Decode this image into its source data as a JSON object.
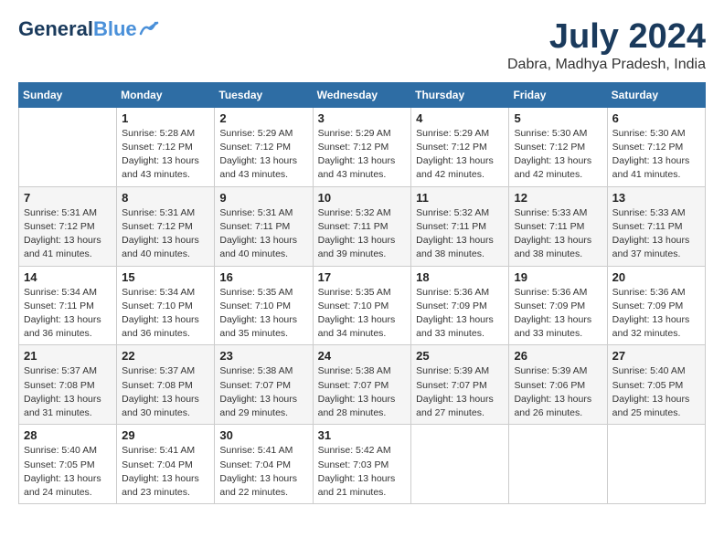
{
  "logo": {
    "line1": "General",
    "line2": "Blue"
  },
  "title": {
    "month_year": "July 2024",
    "location": "Dabra, Madhya Pradesh, India"
  },
  "headers": [
    "Sunday",
    "Monday",
    "Tuesday",
    "Wednesday",
    "Thursday",
    "Friday",
    "Saturday"
  ],
  "weeks": [
    [
      {
        "day": "",
        "info": ""
      },
      {
        "day": "1",
        "info": "Sunrise: 5:28 AM\nSunset: 7:12 PM\nDaylight: 13 hours\nand 43 minutes."
      },
      {
        "day": "2",
        "info": "Sunrise: 5:29 AM\nSunset: 7:12 PM\nDaylight: 13 hours\nand 43 minutes."
      },
      {
        "day": "3",
        "info": "Sunrise: 5:29 AM\nSunset: 7:12 PM\nDaylight: 13 hours\nand 43 minutes."
      },
      {
        "day": "4",
        "info": "Sunrise: 5:29 AM\nSunset: 7:12 PM\nDaylight: 13 hours\nand 42 minutes."
      },
      {
        "day": "5",
        "info": "Sunrise: 5:30 AM\nSunset: 7:12 PM\nDaylight: 13 hours\nand 42 minutes."
      },
      {
        "day": "6",
        "info": "Sunrise: 5:30 AM\nSunset: 7:12 PM\nDaylight: 13 hours\nand 41 minutes."
      }
    ],
    [
      {
        "day": "7",
        "info": "Sunrise: 5:31 AM\nSunset: 7:12 PM\nDaylight: 13 hours\nand 41 minutes."
      },
      {
        "day": "8",
        "info": "Sunrise: 5:31 AM\nSunset: 7:12 PM\nDaylight: 13 hours\nand 40 minutes."
      },
      {
        "day": "9",
        "info": "Sunrise: 5:31 AM\nSunset: 7:11 PM\nDaylight: 13 hours\nand 40 minutes."
      },
      {
        "day": "10",
        "info": "Sunrise: 5:32 AM\nSunset: 7:11 PM\nDaylight: 13 hours\nand 39 minutes."
      },
      {
        "day": "11",
        "info": "Sunrise: 5:32 AM\nSunset: 7:11 PM\nDaylight: 13 hours\nand 38 minutes."
      },
      {
        "day": "12",
        "info": "Sunrise: 5:33 AM\nSunset: 7:11 PM\nDaylight: 13 hours\nand 38 minutes."
      },
      {
        "day": "13",
        "info": "Sunrise: 5:33 AM\nSunset: 7:11 PM\nDaylight: 13 hours\nand 37 minutes."
      }
    ],
    [
      {
        "day": "14",
        "info": "Sunrise: 5:34 AM\nSunset: 7:11 PM\nDaylight: 13 hours\nand 36 minutes."
      },
      {
        "day": "15",
        "info": "Sunrise: 5:34 AM\nSunset: 7:10 PM\nDaylight: 13 hours\nand 36 minutes."
      },
      {
        "day": "16",
        "info": "Sunrise: 5:35 AM\nSunset: 7:10 PM\nDaylight: 13 hours\nand 35 minutes."
      },
      {
        "day": "17",
        "info": "Sunrise: 5:35 AM\nSunset: 7:10 PM\nDaylight: 13 hours\nand 34 minutes."
      },
      {
        "day": "18",
        "info": "Sunrise: 5:36 AM\nSunset: 7:09 PM\nDaylight: 13 hours\nand 33 minutes."
      },
      {
        "day": "19",
        "info": "Sunrise: 5:36 AM\nSunset: 7:09 PM\nDaylight: 13 hours\nand 33 minutes."
      },
      {
        "day": "20",
        "info": "Sunrise: 5:36 AM\nSunset: 7:09 PM\nDaylight: 13 hours\nand 32 minutes."
      }
    ],
    [
      {
        "day": "21",
        "info": "Sunrise: 5:37 AM\nSunset: 7:08 PM\nDaylight: 13 hours\nand 31 minutes."
      },
      {
        "day": "22",
        "info": "Sunrise: 5:37 AM\nSunset: 7:08 PM\nDaylight: 13 hours\nand 30 minutes."
      },
      {
        "day": "23",
        "info": "Sunrise: 5:38 AM\nSunset: 7:07 PM\nDaylight: 13 hours\nand 29 minutes."
      },
      {
        "day": "24",
        "info": "Sunrise: 5:38 AM\nSunset: 7:07 PM\nDaylight: 13 hours\nand 28 minutes."
      },
      {
        "day": "25",
        "info": "Sunrise: 5:39 AM\nSunset: 7:07 PM\nDaylight: 13 hours\nand 27 minutes."
      },
      {
        "day": "26",
        "info": "Sunrise: 5:39 AM\nSunset: 7:06 PM\nDaylight: 13 hours\nand 26 minutes."
      },
      {
        "day": "27",
        "info": "Sunrise: 5:40 AM\nSunset: 7:05 PM\nDaylight: 13 hours\nand 25 minutes."
      }
    ],
    [
      {
        "day": "28",
        "info": "Sunrise: 5:40 AM\nSunset: 7:05 PM\nDaylight: 13 hours\nand 24 minutes."
      },
      {
        "day": "29",
        "info": "Sunrise: 5:41 AM\nSunset: 7:04 PM\nDaylight: 13 hours\nand 23 minutes."
      },
      {
        "day": "30",
        "info": "Sunrise: 5:41 AM\nSunset: 7:04 PM\nDaylight: 13 hours\nand 22 minutes."
      },
      {
        "day": "31",
        "info": "Sunrise: 5:42 AM\nSunset: 7:03 PM\nDaylight: 13 hours\nand 21 minutes."
      },
      {
        "day": "",
        "info": ""
      },
      {
        "day": "",
        "info": ""
      },
      {
        "day": "",
        "info": ""
      }
    ]
  ]
}
